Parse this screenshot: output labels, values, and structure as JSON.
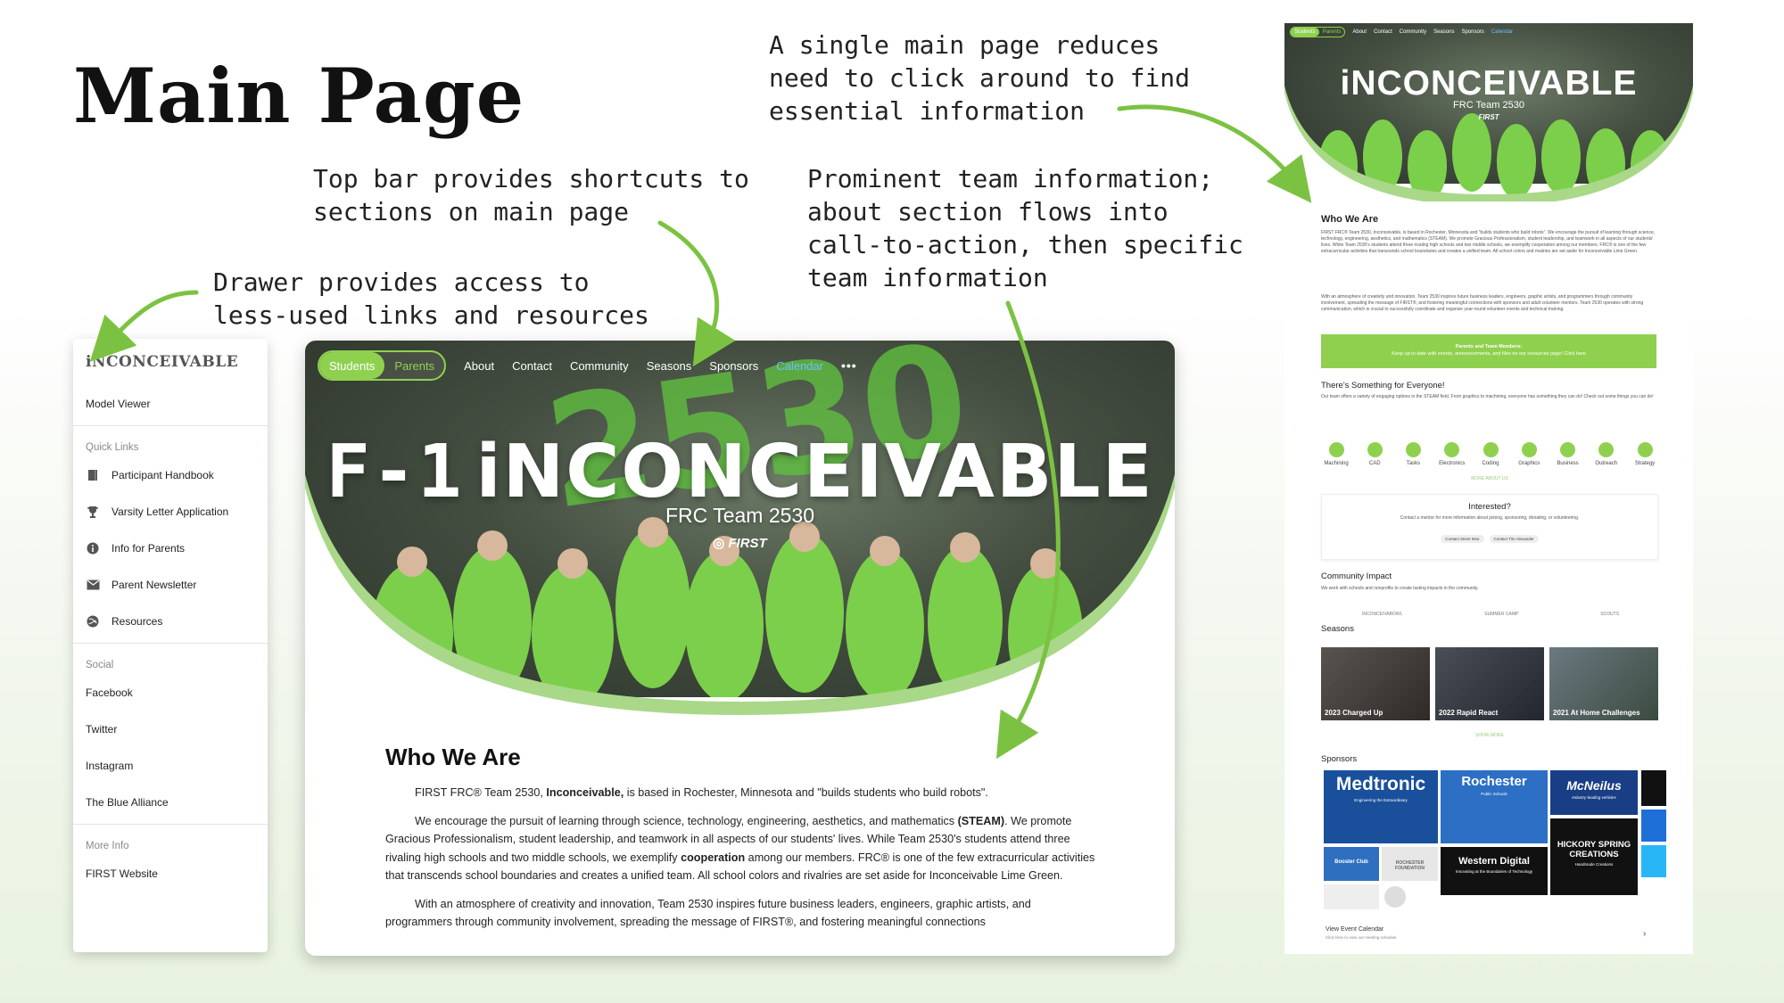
{
  "slide": {
    "title": "Main Page"
  },
  "annotations": {
    "single_page": "A single main page reduces\nneed to click around to find\nessential information",
    "top_bar": "Top bar provides shortcuts to\nsections on main page",
    "prominent": "Prominent team information;\nabout section flows into\ncall-to-action, then specific\nteam information",
    "drawer": "Drawer provides access to\nless-used links and resources"
  },
  "colors": {
    "brand_green": "#8fd14f",
    "link_blue": "#6fc0ff",
    "dark": "#111111"
  },
  "drawer": {
    "logo": "iNCONCEIVABLE",
    "model_viewer": "Model Viewer",
    "quick_links_heading": "Quick Links",
    "quick_links": [
      {
        "label": "Participant Handbook",
        "icon": "book-icon"
      },
      {
        "label": "Varsity Letter Application",
        "icon": "trophy-icon"
      },
      {
        "label": "Info for Parents",
        "icon": "info-icon"
      },
      {
        "label": "Parent Newsletter",
        "icon": "mail-icon"
      },
      {
        "label": "Resources",
        "icon": "globe-icon"
      }
    ],
    "social_heading": "Social",
    "social": [
      "Facebook",
      "Twitter",
      "Instagram",
      "The Blue Alliance"
    ],
    "more_heading": "More Info",
    "more": [
      "FIRST Website"
    ]
  },
  "main_page": {
    "toggle": {
      "on": "Students",
      "off": "Parents"
    },
    "nav": [
      "About",
      "Contact",
      "Community",
      "Seasons",
      "Sponsors",
      "Calendar"
    ],
    "nav_more": "•••",
    "hero_logo": "F-1",
    "hero_title": "iNCONCEIVABLE",
    "hero_subtitle": "FRC Team 2530",
    "hero_first": "FIRST",
    "banner_number": "2530",
    "who_heading": "Who We Are",
    "who_p1_a": "FIRST FRC® Team 2530, ",
    "who_p1_b": "Inconceivable,",
    "who_p1_c": " is based in Rochester, Minnesota and \"builds students who build robots\".",
    "who_p2_a": "We encourage the pursuit of learning through science, technology, engineering, aesthetics, and mathematics ",
    "who_p2_b": "(STEAM)",
    "who_p2_c": ". We promote Gracious Professionalism, student leadership, and teamwork in all aspects of our students' lives. While Team 2530's students attend three rivaling high schools and two middle schools, we exemplify ",
    "who_p2_d": "cooperation",
    "who_p2_e": " among our members. FRC® is one of the few extracurricular activities that transcends school boundaries and creates a unified team. All school colors and rivalries are set aside for Inconceivable Lime Green.",
    "who_p3": "With an atmosphere of creativity and innovation, Team 2530 inspires future business leaders, engineers, graphic artists, and programmers through community involvement, spreading the message of FIRST®, and fostering meaningful connections"
  },
  "full_page": {
    "toggle": {
      "on": "Students",
      "off": "Parents"
    },
    "nav": [
      "About",
      "Contact",
      "Community",
      "Seasons",
      "Sponsors",
      "Calendar"
    ],
    "hero_title": "iNCONCEIVABLE",
    "hero_subtitle": "FRC Team 2530",
    "hero_first": "FIRST",
    "who_heading": "Who We Are",
    "who_text": "FIRST FRC® Team 2530, Inconceivable, is based in Rochester, Minnesota and \"builds students who build robots\". We encourage the pursuit of learning through science, technology, engineering, aesthetics, and mathematics (STEAM). We promote Gracious Professionalism, student leadership, and teamwork in all aspects of our students' lives. While Team 2530's students attend three rivaling high schools and two middle schools, we exemplify cooperation among our members. FRC® is one of the few extracurricular activities that transcends school boundaries and creates a unified team. All school colors and rivalries are set aside for Inconceivable Lime Green.",
    "who_text2": "With an atmosphere of creativity and innovation, Team 2530 inspires future business leaders, engineers, graphic artists, and programmers through community involvement, spreading the message of FIRST®, and fostering meaningful connections with sponsors and adult volunteer mentors. Team 2530 operates with strong communication, which is crucial to successfully coordinate and organize year-round volunteer events and technical training.",
    "banner_line1": "Parents and Team Members:",
    "banner_line2": "Keep up to date with events, announcements, and files on our resources page! Click here",
    "something_heading": "There's Something for Everyone!",
    "something_text": "Our team offers a variety of engaging options in the STEAM field. From graphics to machining, everyone has something they can do! Check out some things you can do!",
    "skills": [
      "Machining",
      "CAD",
      "Tasks",
      "Electronics",
      "Coding",
      "Graphics",
      "Business",
      "Outreach",
      "Strategy"
    ],
    "more_about": "MORE ABOUT US",
    "interested_heading": "Interested?",
    "interested_text": "Contact a mentor for more information about joining, sponsoring, donating, or volunteering.",
    "contact_buttons": [
      "Contact Steve Moe",
      "Contact Tim Alexander"
    ],
    "community_heading": "Community Impact",
    "community_text": "We work with schools and nonprofits to create lasting impacts in the community.",
    "community_items": [
      "INCONCEIVABOWL",
      "SUMMER CAMP",
      "SCOUTS"
    ],
    "seasons_heading": "Seasons",
    "seasons": [
      "2023 Charged Up",
      "2022 Rapid React",
      "2021 At Home Challenges"
    ],
    "show_more": "SHOW MORE",
    "sponsors_heading": "Sponsors",
    "sponsors": [
      {
        "name": "Medtronic",
        "tag": "Engineering the Extraordinary"
      },
      {
        "name": "Rochester",
        "tag": "Public Schools"
      },
      {
        "name": "McNeilus",
        "tag": "Industry-leading vehicles"
      },
      {
        "name": "Western Digital",
        "tag": "Innovating at the Boundaries of Technology"
      },
      {
        "name": "HICKORY SPRING CREATIONS",
        "tag": "Handmade Creations"
      },
      {
        "name": "Booster Club",
        "tag": ""
      },
      {
        "name": "ROCHESTER FOUNDATION",
        "tag": ""
      }
    ],
    "calendar_link": "View Event Calendar",
    "calendar_sub": "Click here to view our meeting schedule"
  }
}
